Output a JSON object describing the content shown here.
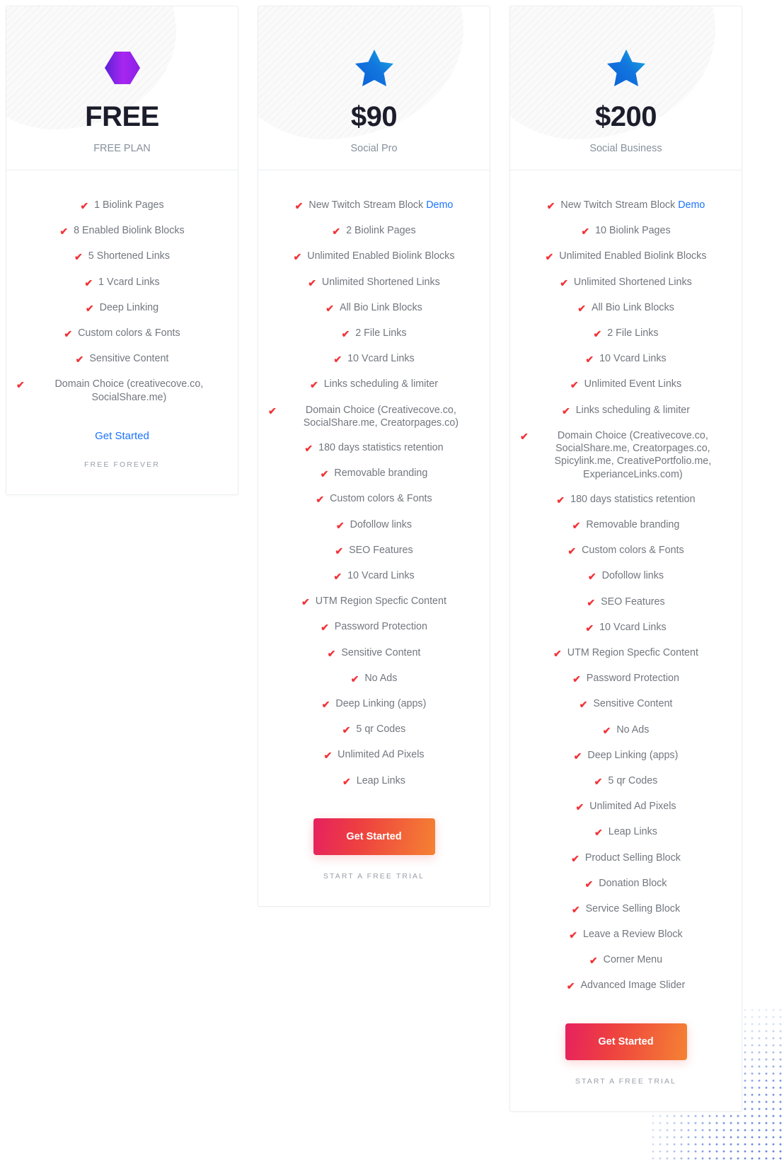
{
  "plans": [
    {
      "icon": "hexagon-icon",
      "price": "FREE",
      "name": "FREE PLAN",
      "features": [
        {
          "text": "1 Biolink Pages"
        },
        {
          "text": "8 Enabled Biolink Blocks"
        },
        {
          "text": "5 Shortened Links"
        },
        {
          "text": "1 Vcard Links"
        },
        {
          "text": "Deep Linking"
        },
        {
          "text": "Custom colors & Fonts"
        },
        {
          "text": "Sensitive Content"
        },
        {
          "text": "Domain Choice (creativecove.co, SocialShare.me)"
        }
      ],
      "cta_type": "link",
      "cta_label": "Get Started",
      "foot_note": "FREE FOREVER"
    },
    {
      "icon": "star-icon",
      "price": "$90",
      "name": "Social Pro",
      "features": [
        {
          "text": "New Twitch Stream Block ",
          "link_label": "Demo"
        },
        {
          "text": "2 Biolink Pages"
        },
        {
          "text": "Unlimited Enabled Biolink Blocks"
        },
        {
          "text": "Unlimited Shortened Links"
        },
        {
          "text": "All Bio Link Blocks"
        },
        {
          "text": "2 File Links"
        },
        {
          "text": "10 Vcard Links"
        },
        {
          "text": "Links scheduling & limiter"
        },
        {
          "text": "Domain Choice (Creativecove.co, SocialShare.me, Creatorpages.co)"
        },
        {
          "text": "180 days statistics retention"
        },
        {
          "text": "Removable branding"
        },
        {
          "text": "Custom colors & Fonts"
        },
        {
          "text": "Dofollow links"
        },
        {
          "text": "SEO Features"
        },
        {
          "text": "10 Vcard Links"
        },
        {
          "text": "UTM Region Specfic Content"
        },
        {
          "text": "Password Protection"
        },
        {
          "text": "Sensitive Content"
        },
        {
          "text": "No Ads"
        },
        {
          "text": "Deep Linking (apps)"
        },
        {
          "text": "5 qr Codes"
        },
        {
          "text": "Unlimited Ad Pixels"
        },
        {
          "text": "Leap Links"
        }
      ],
      "cta_type": "button",
      "cta_label": "Get Started",
      "foot_note": "START A FREE TRIAL"
    },
    {
      "icon": "star-icon",
      "price": "$200",
      "name": "Social Business",
      "features": [
        {
          "text": "New Twitch Stream Block ",
          "link_label": "Demo"
        },
        {
          "text": "10 Biolink Pages"
        },
        {
          "text": "Unlimited Enabled Biolink Blocks"
        },
        {
          "text": "Unlimited Shortened Links"
        },
        {
          "text": "All Bio Link Blocks"
        },
        {
          "text": "2 File Links"
        },
        {
          "text": "10 Vcard Links"
        },
        {
          "text": "Unlimited Event Links"
        },
        {
          "text": "Links scheduling & limiter"
        },
        {
          "text": "Domain Choice (Creativecove.co, SocialShare.me, Creatorpages.co, Spicylink.me, CreativePortfolio.me, ExperianceLinks.com)"
        },
        {
          "text": "180 days statistics retention"
        },
        {
          "text": "Removable branding"
        },
        {
          "text": "Custom colors & Fonts"
        },
        {
          "text": "Dofollow links"
        },
        {
          "text": "SEO Features"
        },
        {
          "text": "10 Vcard Links"
        },
        {
          "text": "UTM Region Specfic Content"
        },
        {
          "text": "Password Protection"
        },
        {
          "text": "Sensitive Content"
        },
        {
          "text": "No Ads"
        },
        {
          "text": "Deep Linking (apps)"
        },
        {
          "text": "5 qr Codes"
        },
        {
          "text": "Unlimited Ad Pixels"
        },
        {
          "text": "Leap Links"
        },
        {
          "text": "Product Selling Block"
        },
        {
          "text": "Donation Block"
        },
        {
          "text": "Service Selling Block"
        },
        {
          "text": "Leave a Review Block"
        },
        {
          "text": "Corner Menu"
        },
        {
          "text": "Advanced Image Slider"
        }
      ],
      "cta_type": "button",
      "cta_label": "Get Started",
      "foot_note": "START A FREE TRIAL"
    }
  ],
  "colors": {
    "check": "#f1353a",
    "link": "#1a73ff",
    "price": "#1b1d2b",
    "feature_text": "#72777f",
    "button_gradient_start": "#e6215f",
    "button_gradient_end": "#f58233",
    "hexagon_gradient_start": "#5b21d8",
    "hexagon_gradient_end": "#a827f0",
    "star_gradient_start": "#0b5fd6",
    "star_gradient_end": "#16b5e0",
    "dot_pattern": "#4a6fd4"
  }
}
